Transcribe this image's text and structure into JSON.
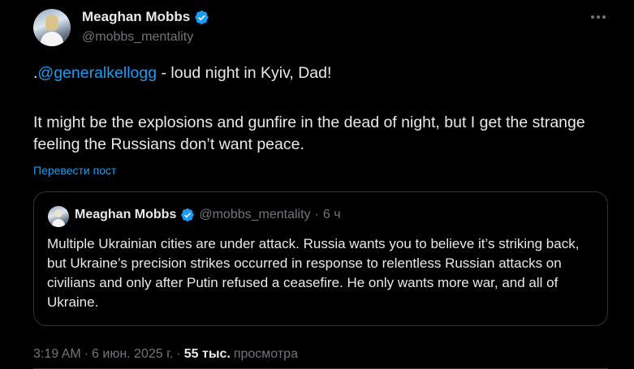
{
  "author": {
    "name": "Meaghan Mobbs",
    "handle": "@mobbs_mentality"
  },
  "post": {
    "prefix": ".",
    "mention": "@generalkellogg",
    "line1_rest": " - loud night in Kyiv, Dad!",
    "line2": "It might be the explosions and gunfire in the dead of night, but I get the strange feeling the Russians don’t want peace.",
    "translate_label": "Перевести пост"
  },
  "quote": {
    "name": "Meaghan Mobbs",
    "handle": "@mobbs_mentality",
    "dot": "·",
    "time": "6 ч",
    "text": "Multiple Ukrainian cities are under attack. Russia wants you to believe it’s striking back, but Ukraine’s precision strikes occurred in response to relentless Russian attacks on civilians and only after Putin refused a ceasefire. He only wants more war, and all of Ukraine."
  },
  "meta": {
    "time": "3:19 AM",
    "dot1": "·",
    "date": "6 июн. 2025 г.",
    "dot2": "·",
    "views_count": "55 тыс.",
    "views_label": "просмотра"
  },
  "colors": {
    "background": "#000000",
    "text": "#e7e9ea",
    "secondary": "#71767b",
    "accent": "#1d9bf0",
    "border": "#2f3336"
  },
  "icons": {
    "verified": "verified-badge-icon",
    "more": "more-options-icon"
  }
}
